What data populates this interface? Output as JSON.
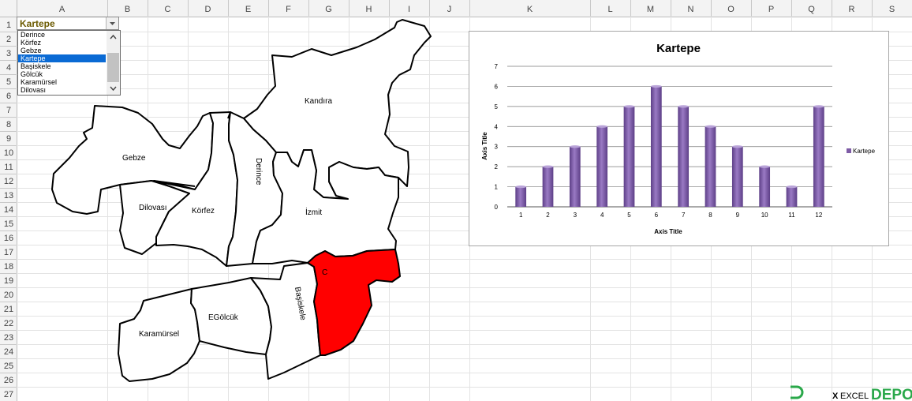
{
  "spreadsheet": {
    "columns": [
      "A",
      "B",
      "C",
      "D",
      "E",
      "F",
      "G",
      "H",
      "I",
      "J",
      "K",
      "L",
      "M",
      "N",
      "O",
      "P",
      "Q",
      "R",
      "S"
    ],
    "rows": [
      "1",
      "2",
      "3",
      "4",
      "5",
      "6",
      "7",
      "8",
      "9",
      "10",
      "11",
      "12",
      "13",
      "14",
      "15",
      "16",
      "17",
      "18",
      "19",
      "20",
      "21",
      "22",
      "23",
      "24",
      "25",
      "26",
      "27"
    ]
  },
  "combo": {
    "value": "Kartepe"
  },
  "dropdown": {
    "options": [
      "Derince",
      "Körfez",
      "Gebze",
      "Kartepe",
      "Başiskele",
      "Gölcük",
      "Karamürsel",
      "Dilovası"
    ],
    "selected_index": 3
  },
  "map": {
    "labels": {
      "kandira": "Kandıra",
      "gebze": "Gebze",
      "derince": "Derince",
      "dilovasi": "Dilovası",
      "korfez": "Körfez",
      "izmit": "İzmit",
      "basiskele": "Başiskele",
      "karamursel": "Karamürsel",
      "golcuk": "EGölcük",
      "kartepe_marker": "C"
    },
    "highlight_color": "#ff0000"
  },
  "chart_data": {
    "type": "bar",
    "title": "Kartepe",
    "xlabel": "Axis Title",
    "ylabel": "Axis Title",
    "categories": [
      "1",
      "2",
      "3",
      "4",
      "5",
      "6",
      "7",
      "8",
      "9",
      "10",
      "11",
      "12"
    ],
    "series": [
      {
        "name": "Kartepe",
        "values": [
          1,
          2,
          3,
          4,
          5,
          6,
          5,
          4,
          3,
          2,
          1,
          5
        ]
      }
    ],
    "ylim": [
      0,
      7
    ],
    "yticks": [
      "0",
      "1",
      "2",
      "3",
      "4",
      "5",
      "6",
      "7"
    ],
    "grid": true,
    "legend": "right",
    "bar_color": "#7e5ba6"
  },
  "logo": {
    "text_excel": "EXCEL",
    "text_depo": "DEPO",
    "brand_color": "#2aa84a"
  }
}
